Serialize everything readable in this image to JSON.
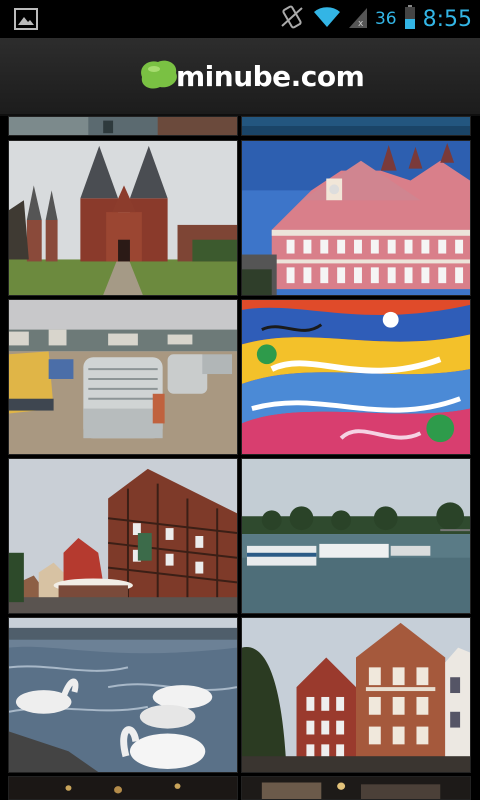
{
  "status_bar": {
    "battery_level": "36",
    "time": "8:55",
    "icons": [
      "picture-notification-icon",
      "rotation-lock-icon",
      "wifi-icon",
      "cell-signal-icon",
      "battery-icon"
    ]
  },
  "app_bar": {
    "logo_text": "minube.com",
    "logo_icon": "minube-blob-icon",
    "logo_color": "#7ac143"
  },
  "grid": {
    "tiles": [
      {
        "id": "partial-top-left",
        "subject": "building-facade"
      },
      {
        "id": "partial-top-right",
        "subject": "water"
      },
      {
        "id": "holstentor",
        "subject": "brick-gate-towers"
      },
      {
        "id": "pink-town-hall",
        "subject": "pink-building"
      },
      {
        "id": "beach-chairs",
        "subject": "beach-chairs"
      },
      {
        "id": "graffiti-wall",
        "subject": "colorful-mural"
      },
      {
        "id": "half-timbered-street",
        "subject": "timber-house-street"
      },
      {
        "id": "lake-boats",
        "subject": "boats-on-lake"
      },
      {
        "id": "swans",
        "subject": "swans-on-water"
      },
      {
        "id": "red-brick-houses",
        "subject": "brick-gabled-houses"
      },
      {
        "id": "partial-bottom-left",
        "subject": "night-scene"
      },
      {
        "id": "partial-bottom-right",
        "subject": "night-scene"
      }
    ]
  }
}
